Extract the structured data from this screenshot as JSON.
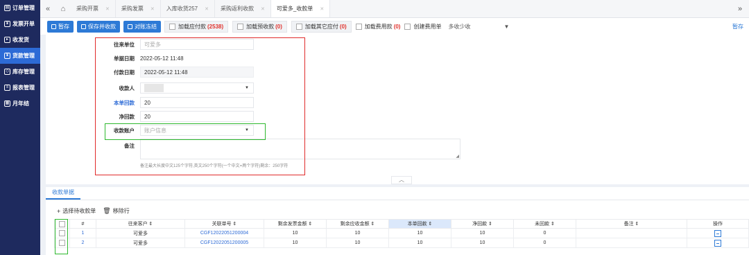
{
  "sidebar": {
    "items": [
      {
        "label": "订单管理",
        "icon": "order-icon"
      },
      {
        "label": "发票开单",
        "icon": "invoice-icon"
      },
      {
        "label": "收发货",
        "icon": "truck-icon"
      },
      {
        "label": "货款管理",
        "icon": "payment-icon",
        "active": true
      },
      {
        "label": "库存管理",
        "icon": "inventory-icon"
      },
      {
        "label": "报表管理",
        "icon": "report-icon"
      },
      {
        "label": "月年结",
        "icon": "calendar-icon"
      }
    ]
  },
  "tabs": [
    {
      "label": "采购开票"
    },
    {
      "label": "采购发票"
    },
    {
      "label": "入库收货257"
    },
    {
      "label": "采购返利收款"
    },
    {
      "label": "可爱多_收款单",
      "active": true
    }
  ],
  "toolbar": {
    "save_label": "暂存",
    "save_collect_label": "保存并收款",
    "reconcile_label": "对账冻结",
    "load_payable_label": "加载应付款",
    "load_payable_count": "(2538)",
    "load_prepay_label": "加载预收款",
    "load_prepay_count": "(0)",
    "load_other_label": "加载其它应付",
    "load_other_count": "(0)",
    "load_fee_label": "加载费用款",
    "load_fee_count": "(0)",
    "create_fee_label": "创建费用单",
    "multi_collect_label": "多收少收",
    "stash_label": "暂存"
  },
  "form": {
    "partner_label": "往来单位",
    "partner_value": "可爱多",
    "doc_date_label": "单据日期",
    "doc_date_value": "2022-05-12 11:48",
    "pay_date_label": "付款日期",
    "pay_date_value": "2022-05-12 11:48",
    "payee_label": "收款人",
    "this_return_label": "本单回款",
    "this_return_value": "20",
    "net_return_label": "净回款",
    "net_return_value": "20",
    "account_label": "收款账户",
    "account_placeholder": "账户信息",
    "remark_label": "备注",
    "remark_note": "备注最大长度中文125个字符,英文250个字符(一个中文=两个字符)剩余：250字符"
  },
  "collapse_icon": "chevron-up-icon",
  "bottom": {
    "tab_label": "收款单据",
    "select_label": "选择待收款单",
    "remove_label": "移除行",
    "columns": [
      "#",
      "往来客户 ⇕",
      "关联单号 ⇕",
      "剩余发票金额 ⇕",
      "剩余应收金额 ⇕",
      "本单回款 ⇕",
      "净回款 ⇕",
      "未回款 ⇕",
      "备注 ⇕",
      "操作"
    ],
    "rows": [
      {
        "idx": "1",
        "customer": "可爱多",
        "doc_no": "CGF12022051200004",
        "inv_remain": "10",
        "recv_remain": "10",
        "this_return": "10",
        "net_return": "10",
        "unreturned": "0",
        "remark": ""
      },
      {
        "idx": "2",
        "customer": "可爱多",
        "doc_no": "CGF12022051200005",
        "inv_remain": "10",
        "recv_remain": "10",
        "this_return": "10",
        "net_return": "10",
        "unreturned": "0",
        "remark": ""
      }
    ]
  },
  "colors": {
    "sidebar": "#1e2a5e",
    "accent": "#2d7ad6",
    "highlight_red": "#e02a2a",
    "highlight_green": "#2eb82e"
  }
}
